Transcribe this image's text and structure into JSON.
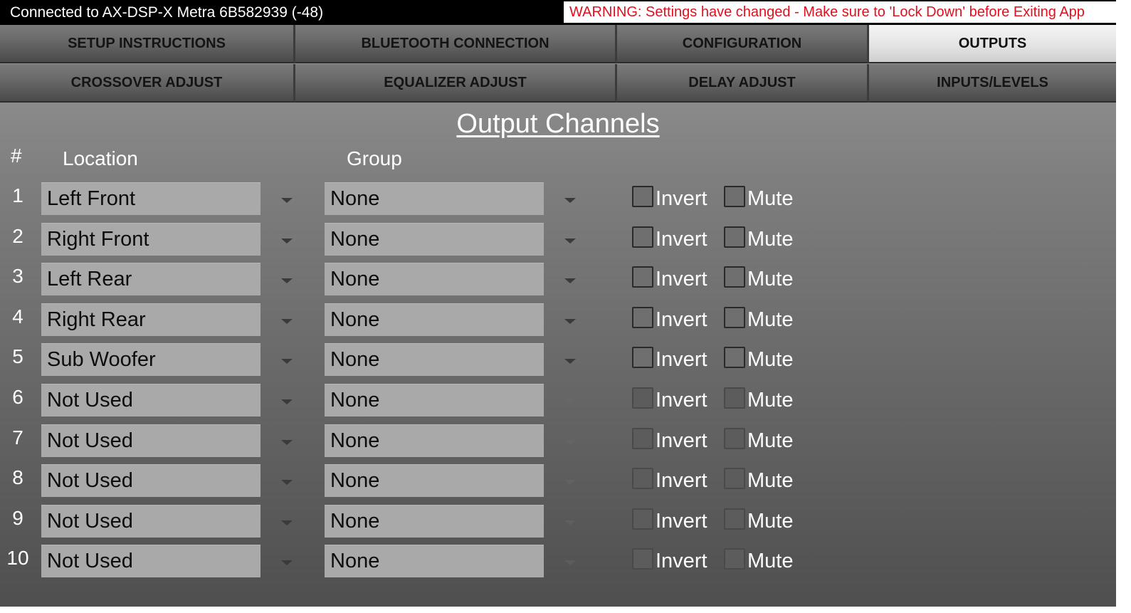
{
  "status": {
    "connection": "Connected to AX-DSP-X Metra 6B582939 (-48)",
    "warning": "WARNING: Settings have changed - Make sure to 'Lock Down' before Exiting App"
  },
  "tabs": [
    {
      "label": "SETUP INSTRUCTIONS",
      "active": false
    },
    {
      "label": "BLUETOOTH CONNECTION",
      "active": false
    },
    {
      "label": "CONFIGURATION",
      "active": false
    },
    {
      "label": "OUTPUTS",
      "active": true
    },
    {
      "label": "CROSSOVER ADJUST",
      "active": false
    },
    {
      "label": "EQUALIZER ADJUST",
      "active": false
    },
    {
      "label": "DELAY ADJUST",
      "active": false
    },
    {
      "label": "INPUTS/LEVELS",
      "active": false
    }
  ],
  "main": {
    "title": "Output Channels",
    "headers": {
      "number": "#",
      "location": "Location",
      "group": "Group"
    },
    "invert_label": "Invert",
    "mute_label": "Mute",
    "channels": [
      {
        "num": "1",
        "location": "Left Front",
        "group": "None",
        "invert": false,
        "mute": false,
        "enabled": true
      },
      {
        "num": "2",
        "location": "Right Front",
        "group": "None",
        "invert": false,
        "mute": false,
        "enabled": true
      },
      {
        "num": "3",
        "location": "Left Rear",
        "group": "None",
        "invert": false,
        "mute": false,
        "enabled": true
      },
      {
        "num": "4",
        "location": "Right Rear",
        "group": "None",
        "invert": false,
        "mute": false,
        "enabled": true
      },
      {
        "num": "5",
        "location": "Sub Woofer",
        "group": "None",
        "invert": false,
        "mute": false,
        "enabled": true
      },
      {
        "num": "6",
        "location": "Not Used",
        "group": "None",
        "invert": false,
        "mute": false,
        "enabled": false
      },
      {
        "num": "7",
        "location": "Not Used",
        "group": "None",
        "invert": false,
        "mute": false,
        "enabled": false
      },
      {
        "num": "8",
        "location": "Not Used",
        "group": "None",
        "invert": false,
        "mute": false,
        "enabled": false
      },
      {
        "num": "9",
        "location": "Not Used",
        "group": "None",
        "invert": false,
        "mute": false,
        "enabled": false
      },
      {
        "num": "10",
        "location": "Not Used",
        "group": "None",
        "invert": false,
        "mute": false,
        "enabled": false
      }
    ]
  }
}
